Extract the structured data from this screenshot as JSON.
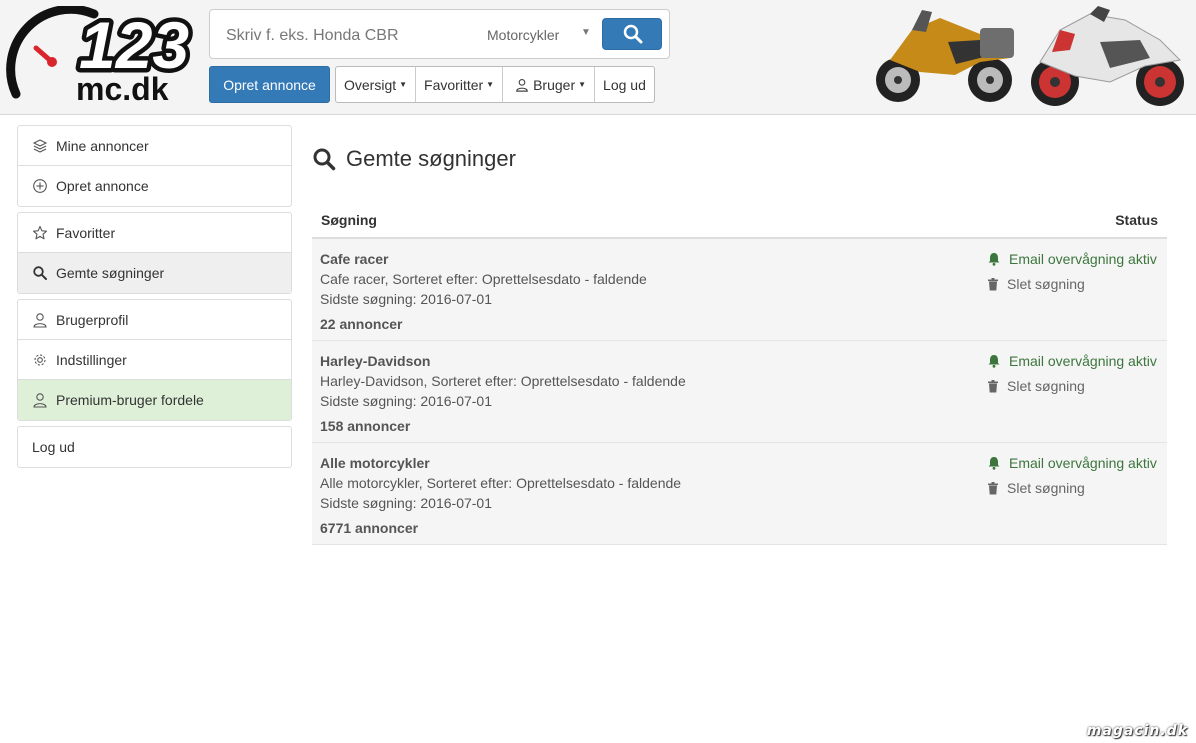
{
  "header": {
    "logo_number": "123",
    "logo_domain": "mc.dk",
    "search": {
      "placeholder": "Skriv f. eks. Honda CBR",
      "category": "Motorcykler"
    },
    "create_button": "Opret annonce",
    "nav": [
      {
        "label": "Oversigt",
        "dropdown": true
      },
      {
        "label": "Favoritter",
        "dropdown": true
      },
      {
        "label": "Bruger",
        "dropdown": true
      },
      {
        "label": "Log ud",
        "dropdown": false
      }
    ]
  },
  "sidebar": {
    "groups": [
      [
        {
          "label": "Mine annoncer",
          "icon": "layers-icon"
        },
        {
          "label": "Opret annonce",
          "icon": "plus-circle-icon"
        }
      ],
      [
        {
          "label": "Favoritter",
          "icon": "star-icon"
        },
        {
          "label": "Gemte søgninger",
          "icon": "search-icon",
          "active": true
        }
      ],
      [
        {
          "label": "Brugerprofil",
          "icon": "user-icon"
        },
        {
          "label": "Indstillinger",
          "icon": "gear-icon"
        },
        {
          "label": "Premium-bruger fordele",
          "icon": "user-icon",
          "highlight": true
        }
      ],
      [
        {
          "label": "Log ud"
        }
      ]
    ]
  },
  "main": {
    "title": "Gemte søgninger",
    "columns": {
      "search": "Søgning",
      "status": "Status"
    },
    "rows": [
      {
        "title": "Cafe racer",
        "desc": "Cafe racer, Sorteret efter: Oprettelsesdato - faldende",
        "date": "Sidste søgning: 2016-07-01",
        "count": "22 annoncer",
        "email": "Email overvågning aktiv",
        "delete": "Slet søgning"
      },
      {
        "title": "Harley-Davidson",
        "desc": "Harley-Davidson, Sorteret efter: Oprettelsesdato - faldende",
        "date": "Sidste søgning: 2016-07-01",
        "count": "158 annoncer",
        "email": "Email overvågning aktiv",
        "delete": "Slet søgning"
      },
      {
        "title": "Alle motorcykler",
        "desc": "Alle motorcykler, Sorteret efter: Oprettelsesdato - faldende",
        "date": "Sidste søgning: 2016-07-01",
        "count": "6771 annoncer",
        "email": "Email overvågning aktiv",
        "delete": "Slet søgning"
      }
    ]
  },
  "watermark": "magacin.dk",
  "colors": {
    "primary": "#337ab7",
    "success": "#3c763d",
    "premium_bg": "#dff0d8",
    "active_bg": "#efefef",
    "logo_red": "#d9262c"
  }
}
